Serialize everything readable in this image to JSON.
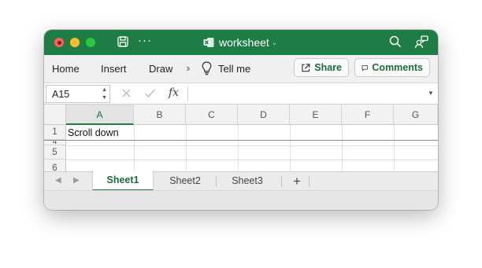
{
  "window": {
    "title": "worksheet",
    "app_icon": "excel-icon",
    "accent_color": "#1e7d45"
  },
  "ribbon": {
    "tabs": [
      "Home",
      "Insert",
      "Draw"
    ],
    "more_icon": "chevron-double-right-icon",
    "tell_me": "Tell me",
    "share_label": "Share",
    "comments_label": "Comments"
  },
  "formula_bar": {
    "name_box": "A15",
    "fx_label": "fx",
    "formula_value": ""
  },
  "grid": {
    "columns": [
      "A",
      "B",
      "C",
      "D",
      "E",
      "F",
      "G"
    ],
    "active_column": "A",
    "rows": [
      "1",
      "4",
      "5",
      "6"
    ],
    "cells": {
      "A1": "Scroll down"
    }
  },
  "sheets": {
    "tabs": [
      "Sheet1",
      "Sheet2",
      "Sheet3"
    ],
    "active": "Sheet1",
    "add_label": "+"
  }
}
